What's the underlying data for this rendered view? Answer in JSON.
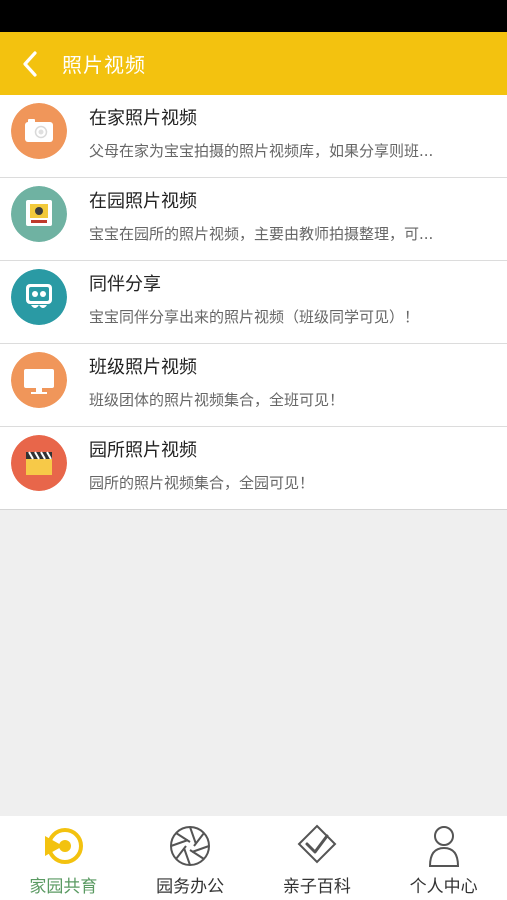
{
  "header": {
    "title": "照片视频"
  },
  "items": [
    {
      "title": "在家照片视频",
      "desc": "父母在家为宝宝拍摄的照片视频库，如果分享则班...",
      "icon": "camera-icon",
      "color": "#f0965a"
    },
    {
      "title": "在园照片视频",
      "desc": "宝宝在园所的照片视频，主要由教师拍摄整理，可...",
      "icon": "polaroid-icon",
      "color": "#6fb2a2"
    },
    {
      "title": "同伴分享",
      "desc": "宝宝同伴分享出来的照片视频（班级同学可见）！",
      "icon": "share-icon",
      "color": "#2a9aa4"
    },
    {
      "title": "班级照片视频",
      "desc": "班级团体的照片视频集合，全班可见！",
      "icon": "monitor-icon",
      "color": "#f0965a"
    },
    {
      "title": "园所照片视频",
      "desc": "园所的照片视频集合，全园可见！",
      "icon": "clapper-icon",
      "color": "#e8664a"
    }
  ],
  "tabs": [
    {
      "label": "家园共育",
      "icon": "home-school-icon",
      "active": true
    },
    {
      "label": "园务办公",
      "icon": "aperture-icon",
      "active": false
    },
    {
      "label": "亲子百科",
      "icon": "check-badge-icon",
      "active": false
    },
    {
      "label": "个人中心",
      "icon": "person-icon",
      "active": false
    }
  ],
  "colors": {
    "header": "#f3c20f",
    "active_tab": "#5a9a62"
  }
}
